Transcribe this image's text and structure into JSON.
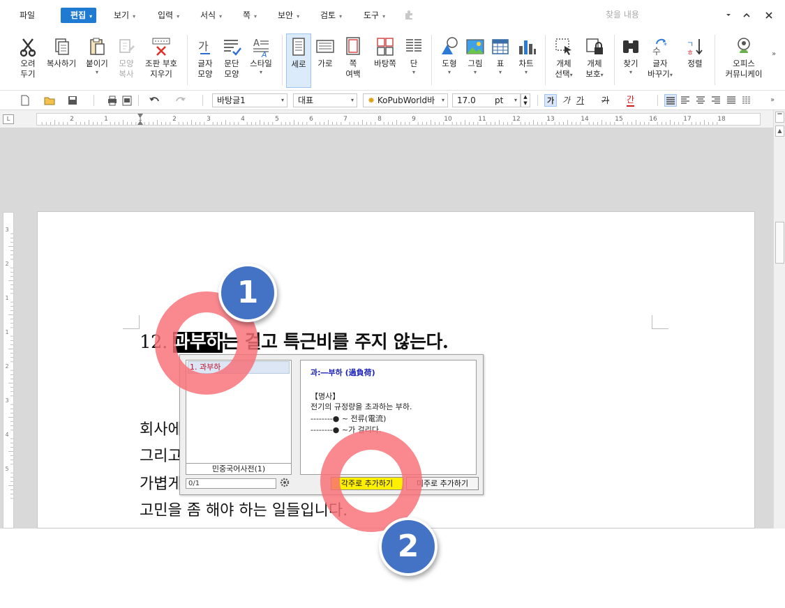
{
  "menu": {
    "items": [
      {
        "label": "파일",
        "caret": false,
        "active": false
      },
      {
        "label": "편집",
        "caret": true,
        "active": true
      },
      {
        "label": "보기",
        "caret": true,
        "active": false
      },
      {
        "label": "입력",
        "caret": true,
        "active": false
      },
      {
        "label": "서식",
        "caret": true,
        "active": false
      },
      {
        "label": "쪽",
        "caret": true,
        "active": false
      },
      {
        "label": "보안",
        "caret": true,
        "active": false
      },
      {
        "label": "검토",
        "caret": true,
        "active": false
      },
      {
        "label": "도구",
        "caret": true,
        "active": false
      }
    ],
    "search_placeholder": "찾을 내용",
    "caret_glyph": "▾"
  },
  "ribbon": {
    "cut": [
      "오려",
      "두기"
    ],
    "copy": "복사하기",
    "paste": "붙이기",
    "format_copy": [
      "모양",
      "복사"
    ],
    "erase_marks": [
      "조판 부호",
      "지우기"
    ],
    "char_shape": [
      "글자",
      "모양"
    ],
    "para_shape": [
      "문단",
      "모양"
    ],
    "style": "스타일",
    "portrait": "세로",
    "landscape": "가로",
    "margin": [
      "쪽",
      "여백"
    ],
    "page_bg": "바탕쪽",
    "columns": "단",
    "shape": "도형",
    "picture": "그림",
    "table": "표",
    "chart": "차트",
    "select_object": [
      "개체",
      "선택"
    ],
    "protect_object": [
      "개체",
      "보호"
    ],
    "find": "찾기",
    "replace": [
      "글자",
      "바꾸기"
    ],
    "sort": "정렬",
    "office_community": [
      "오피스",
      "커뮤니케이"
    ]
  },
  "format": {
    "style": "바탕글1",
    "lang": "대표",
    "font": "KoPubWorld바",
    "size": "17.0",
    "unit": "pt",
    "bold": "가",
    "italic": "가",
    "underline": "가",
    "strike": "가",
    "color": "간"
  },
  "ruler": {
    "numbers": [
      "2",
      "1",
      "1",
      "2",
      "3",
      "4",
      "5",
      "6",
      "7",
      "8",
      "9",
      "10",
      "11",
      "12",
      "13",
      "14",
      "15",
      "16",
      "17",
      "18"
    ],
    "vnumbers": [
      "3",
      "2",
      "1",
      "1",
      "2",
      "3",
      "4",
      "5"
    ]
  },
  "document": {
    "num": "12.",
    "selected": "과부하",
    "rest": "는 걸고 특근비를 주지 않는다.",
    "lines": [
      "회사에",
      "그리고",
      "가볍게",
      "고민을 좀 해야 하는 일들입니다."
    ]
  },
  "dictionary": {
    "list_item": "1. 과부하",
    "source": "민중국어사전(1)",
    "count": "0/1",
    "headword": "과:―부하 (過負荷)",
    "pos": "【명사】",
    "definition": "전기의 규정량을 초과하는 부하.",
    "example1": "--------● ~ 전류(電流)",
    "example2": "--------● ~가 걸리다.",
    "footnote_button": "각주로 추가하기",
    "endnote_button": "미주로 추가하기"
  },
  "annotations": {
    "badge1": "1",
    "badge2": "2"
  },
  "colors": {
    "accent": "#1f7ad2",
    "badge": "#4472c4",
    "ring": "#f86e76",
    "highlight": "#ffef00",
    "headword": "#1a22b8"
  }
}
